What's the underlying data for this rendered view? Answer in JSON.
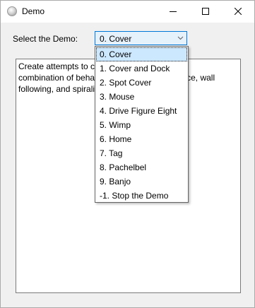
{
  "window": {
    "title": "Demo",
    "app_icon": "app-sphere-icon",
    "controls": {
      "minimize_icon": "minimize-icon",
      "maximize_icon": "maximize-icon",
      "close_icon": "close-icon"
    }
  },
  "form": {
    "select_label": "Select the Demo:",
    "selected_demo": "0. Cover",
    "dropdown_icon": "chevron-down-icon",
    "description": "Create attempts to c                                    a\ncombination of beha                                   unce, wall\nfollowing, and spirali"
  },
  "dropdown": {
    "items": [
      "0. Cover",
      "1. Cover and Dock",
      "2. Spot Cover",
      "3. Mouse",
      "4. Drive Figure Eight",
      "5. Wimp",
      "6. Home",
      "7. Tag",
      "8. Pachelbel",
      "9. Banjo",
      "-1. Stop the Demo"
    ],
    "selected_index": 0
  },
  "colors": {
    "accent": "#0078d7",
    "selection": "#cce8ff",
    "window_bg": "#f0f0f0"
  }
}
